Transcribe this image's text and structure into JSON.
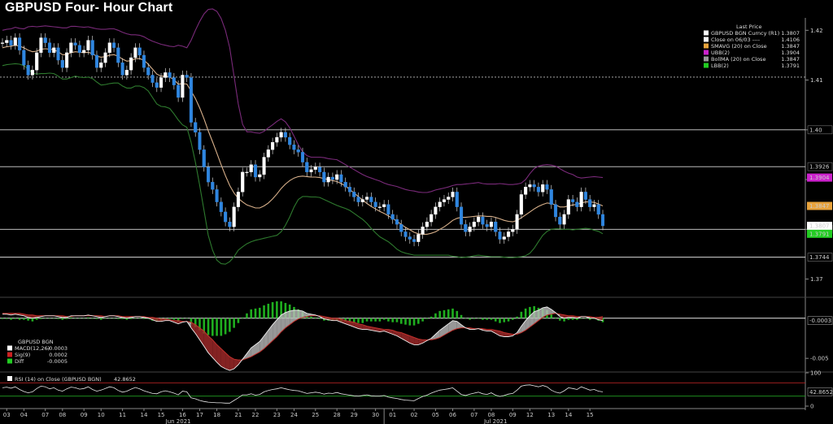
{
  "title": "GBPUSD Four- Hour Chart",
  "chart_data": [
    {
      "type": "candlestick",
      "panel": "price",
      "legend_header": "Last Price",
      "legend": [
        {
          "label": "GBPUSD BGN Curncy  (R1)",
          "value": "1.3807",
          "color": "#ffffff"
        },
        {
          "label": "Close on 06/03  ----",
          "value": "1.4106",
          "color": "#ffffff"
        },
        {
          "label": "SMAVG (20)  on Close",
          "value": "1.3847",
          "color": "#e8a33c"
        },
        {
          "label": "UBB(2)",
          "value": "1.3904",
          "color": "#cc22cc"
        },
        {
          "label": "BollMA (20)  on Close",
          "value": "1.3847",
          "color": "#999999"
        },
        {
          "label": "LBB(2)",
          "value": "1.3791",
          "color": "#22cc22"
        }
      ],
      "y_ticks": [
        "1.42",
        "1.41",
        "1.40",
        "1.39",
        "1.38",
        "1.37"
      ],
      "ylim": [
        1.3665,
        1.4225
      ],
      "horizontal_lines": [
        1.4106,
        1.4,
        1.3926,
        1.38,
        1.3744
      ],
      "line_labels": [
        "1.40",
        "1.3926",
        "1.38",
        "1.3744"
      ],
      "price_tags": [
        {
          "text": "1.3904",
          "value": 1.3904,
          "color": "#cc22cc"
        },
        {
          "text": "1.3847",
          "value": 1.3847,
          "color": "#e8a33c"
        },
        {
          "text": "1.3807",
          "value": 1.3807,
          "color": "#ffffff"
        },
        {
          "text": "1.3791",
          "value": 1.3791,
          "color": "#22cc22"
        }
      ],
      "closes": [
        1.4175,
        1.418,
        1.417,
        1.4185,
        1.416,
        1.413,
        1.411,
        1.412,
        1.4155,
        1.4185,
        1.4175,
        1.4155,
        1.4165,
        1.414,
        1.4125,
        1.4155,
        1.4175,
        1.417,
        1.4155,
        1.416,
        1.418,
        1.415,
        1.4125,
        1.4135,
        1.4155,
        1.4175,
        1.4165,
        1.4135,
        1.411,
        1.412,
        1.4145,
        1.4165,
        1.415,
        1.4125,
        1.411,
        1.4095,
        1.4085,
        1.4105,
        1.4115,
        1.4105,
        1.409,
        1.4065,
        1.411,
        1.4105,
        1.4015,
        1.3995,
        1.396,
        1.3925,
        1.3895,
        1.388,
        1.3855,
        1.3835,
        1.3815,
        1.3805,
        1.3845,
        1.3875,
        1.3915,
        1.3915,
        1.393,
        1.3905,
        1.391,
        1.3945,
        1.396,
        1.3975,
        1.3985,
        1.3995,
        1.3985,
        1.397,
        1.396,
        1.3955,
        1.3935,
        1.3915,
        1.392,
        1.3925,
        1.3915,
        1.3895,
        1.3905,
        1.39,
        1.391,
        1.3895,
        1.3885,
        1.3875,
        1.3865,
        1.3855,
        1.386,
        1.3865,
        1.3855,
        1.3845,
        1.3845,
        1.385,
        1.383,
        1.382,
        1.381,
        1.3795,
        1.3785,
        1.378,
        1.3775,
        1.379,
        1.3805,
        1.3815,
        1.383,
        1.3845,
        1.3855,
        1.386,
        1.3865,
        1.3875,
        1.3845,
        1.381,
        1.3795,
        1.3805,
        1.3815,
        1.3825,
        1.381,
        1.3805,
        1.3815,
        1.3795,
        1.378,
        1.3785,
        1.3795,
        1.38,
        1.383,
        1.387,
        1.3885,
        1.389,
        1.3885,
        1.3875,
        1.389,
        1.388,
        1.385,
        1.3825,
        1.381,
        1.383,
        1.386,
        1.3855,
        1.3845,
        1.3875,
        1.386,
        1.3845,
        1.385,
        1.383,
        1.3807
      ],
      "sma20": [
        1.4165,
        1.4167,
        1.4168,
        1.417,
        1.4168,
        1.4165,
        1.416,
        1.4157,
        1.4158,
        1.4162,
        1.4163,
        1.4162,
        1.4161,
        1.4157,
        1.4151,
        1.4151,
        1.4155,
        1.4157,
        1.4156,
        1.4155,
        1.4156,
        1.4153,
        1.4148,
        1.4146,
        1.4147,
        1.415,
        1.4151,
        1.4148,
        1.4142,
        1.4138,
        1.4139,
        1.4143,
        1.4143,
        1.414,
        1.4132,
        1.4122,
        1.4112,
        1.4108,
        1.4108,
        1.4106,
        1.4101,
        1.4092,
        1.4093,
        1.4092,
        1.4078,
        1.4063,
        1.4044,
        1.4022,
        1.3998,
        1.3976,
        1.3953,
        1.393,
        1.3908,
        1.3888,
        1.3873,
        1.3862,
        1.3855,
        1.3849,
        1.3846,
        1.3843,
        1.3843,
        1.3847,
        1.3853,
        1.3861,
        1.3871,
        1.3882,
        1.3891,
        1.3898,
        1.3903,
        1.3906,
        1.3907,
        1.3906,
        1.3905,
        1.3905,
        1.3904,
        1.3902,
        1.39,
        1.3898,
        1.3896,
        1.3892,
        1.3887,
        1.388,
        1.3873,
        1.3866,
        1.3859,
        1.3852,
        1.3846,
        1.3841,
        1.3836,
        1.3832,
        1.3827,
        1.3822,
        1.3816,
        1.381,
        1.3804,
        1.3799,
        1.3794,
        1.3791,
        1.379,
        1.379,
        1.3792,
        1.3795,
        1.38,
        1.3805,
        1.3811,
        1.3818,
        1.3822,
        1.3824,
        1.3824,
        1.3825,
        1.3826,
        1.3827,
        1.3827,
        1.3826,
        1.3826,
        1.3824,
        1.3821,
        1.3818,
        1.3816,
        1.3815,
        1.3818,
        1.3823,
        1.3829,
        1.3835,
        1.3841,
        1.3846,
        1.385,
        1.3853,
        1.3852,
        1.3849,
        1.3845,
        1.3845,
        1.3847,
        1.3849,
        1.385,
        1.3853,
        1.3855,
        1.3855,
        1.3854,
        1.3851,
        1.3847
      ],
      "ubb": [
        1.42,
        1.4202,
        1.4203,
        1.4206,
        1.4204,
        1.4203,
        1.4207,
        1.4208,
        1.4207,
        1.4208,
        1.4209,
        1.4208,
        1.4207,
        1.4206,
        1.4205,
        1.4205,
        1.4208,
        1.4208,
        1.4207,
        1.4206,
        1.4207,
        1.4205,
        1.4203,
        1.4202,
        1.4202,
        1.4203,
        1.4203,
        1.42,
        1.4196,
        1.4193,
        1.4191,
        1.4191,
        1.419,
        1.4187,
        1.4182,
        1.4178,
        1.4175,
        1.4172,
        1.417,
        1.4168,
        1.4167,
        1.417,
        1.4168,
        1.4165,
        1.418,
        1.42,
        1.4218,
        1.4233,
        1.4242,
        1.4243,
        1.4238,
        1.4224,
        1.42,
        1.4165,
        1.4108,
        1.4052,
        1.4011,
        1.3996,
        1.3996,
        1.3994,
        1.3993,
        1.3997,
        1.4004,
        1.401,
        1.4017,
        1.4022,
        1.4016,
        1.4004,
        1.3987,
        1.397,
        1.3956,
        1.3948,
        1.3945,
        1.3945,
        1.3945,
        1.3944,
        1.3942,
        1.3941,
        1.394,
        1.3935,
        1.393,
        1.3925,
        1.392,
        1.3915,
        1.391,
        1.3906,
        1.3903,
        1.39,
        1.3897,
        1.3893,
        1.389,
        1.3888,
        1.3886,
        1.3883,
        1.388,
        1.3878,
        1.3877,
        1.3875,
        1.3874,
        1.3874,
        1.3876,
        1.3879,
        1.3881,
        1.3883,
        1.3885,
        1.3888,
        1.389,
        1.389,
        1.3891,
        1.3892,
        1.3893,
        1.3894,
        1.3892,
        1.3891,
        1.3891,
        1.3891,
        1.3892,
        1.3891,
        1.389,
        1.389,
        1.3891,
        1.3893,
        1.39,
        1.3912,
        1.3922,
        1.3927,
        1.3929,
        1.393,
        1.3929,
        1.3927,
        1.3922,
        1.3917,
        1.3913,
        1.391,
        1.3905,
        1.3903,
        1.3904,
        1.3905,
        1.3906,
        1.3905,
        1.3904
      ],
      "lbb": [
        1.4129,
        1.4131,
        1.4132,
        1.4133,
        1.4132,
        1.4129,
        1.4122,
        1.4114,
        1.4112,
        1.4113,
        1.4113,
        1.4114,
        1.4113,
        1.4108,
        1.4102,
        1.4102,
        1.4105,
        1.4108,
        1.4106,
        1.4105,
        1.4106,
        1.4103,
        1.4096,
        1.409,
        1.4091,
        1.4093,
        1.4094,
        1.4094,
        1.4088,
        1.4084,
        1.4084,
        1.4088,
        1.4088,
        1.4085,
        1.4078,
        1.4065,
        1.4052,
        1.4047,
        1.4046,
        1.4043,
        1.4032,
        1.402,
        1.401,
        1.4005,
        1.3975,
        1.3935,
        1.3888,
        1.3838,
        1.3788,
        1.3758,
        1.3738,
        1.3731,
        1.373,
        1.3735,
        1.3745,
        1.3758,
        1.3765,
        1.3771,
        1.3775,
        1.3778,
        1.378,
        1.3782,
        1.3784,
        1.3786,
        1.3788,
        1.3795,
        1.3808,
        1.3825,
        1.3845,
        1.386,
        1.3866,
        1.3866,
        1.3865,
        1.3865,
        1.3864,
        1.386,
        1.3856,
        1.3852,
        1.3848,
        1.3845,
        1.3842,
        1.3838,
        1.3832,
        1.3826,
        1.382,
        1.3812,
        1.3802,
        1.3793,
        1.3785,
        1.378,
        1.3775,
        1.3768,
        1.376,
        1.3755,
        1.3752,
        1.375,
        1.3748,
        1.3748,
        1.3748,
        1.3748,
        1.3748,
        1.3748,
        1.3748,
        1.3748,
        1.3748,
        1.3746,
        1.3745,
        1.3743,
        1.3744,
        1.3745,
        1.3747,
        1.3748,
        1.3747,
        1.3746,
        1.3745,
        1.3745,
        1.3745,
        1.3744,
        1.3743,
        1.3743,
        1.3744,
        1.3745,
        1.3747,
        1.3752,
        1.3762,
        1.3775,
        1.3788,
        1.3796,
        1.38,
        1.3801,
        1.3801,
        1.38,
        1.38,
        1.3799,
        1.38,
        1.3801,
        1.3802,
        1.3801,
        1.3798,
        1.3796,
        1.3791
      ]
    },
    {
      "type": "macd",
      "panel": "macd",
      "legend_header": "GBPUSD BGN",
      "legend": [
        {
          "label": "MACD(12,26)",
          "value": "-0.0003",
          "color": "#ffffff"
        },
        {
          "label": "Sig(9)",
          "value": "0.0002",
          "color": "#cc2222"
        },
        {
          "label": "Diff",
          "value": "-0.0005",
          "color": "#22cc22"
        }
      ],
      "y_ticks": [
        "-0.005"
      ],
      "ylim": [
        -0.0065,
        0.0022
      ],
      "last_tag": "-0.0003",
      "last_tag_value": -0.0003,
      "macd": [
        0.0005,
        0.0005,
        0.0004,
        0.0005,
        0.0004,
        0.0003,
        0.0001,
        0.0,
        0.0001,
        0.0002,
        0.0003,
        0.0003,
        0.0003,
        0.0002,
        0.0001,
        0.0001,
        0.0003,
        0.0003,
        0.0003,
        0.0003,
        0.0004,
        0.0003,
        0.0002,
        0.0001,
        0.0002,
        0.0003,
        0.0003,
        0.0002,
        0.0001,
        0.0,
        0.0001,
        0.0002,
        0.0002,
        0.0001,
        -0.0,
        -0.0002,
        -0.0004,
        -0.0004,
        -0.0003,
        -0.0003,
        -0.0005,
        -0.0007,
        -0.0005,
        -0.0004,
        -0.0012,
        -0.0019,
        -0.0027,
        -0.0035,
        -0.0043,
        -0.0049,
        -0.0055,
        -0.006,
        -0.0063,
        -0.0065,
        -0.0063,
        -0.0058,
        -0.0051,
        -0.0044,
        -0.0037,
        -0.0033,
        -0.0029,
        -0.0022,
        -0.0015,
        -0.0008,
        -0.0002,
        0.0004,
        0.0007,
        0.0009,
        0.001,
        0.001,
        0.0009,
        0.0006,
        0.0005,
        0.0004,
        0.0002,
        -0.0001,
        -0.0002,
        -0.0003,
        -0.0003,
        -0.0005,
        -0.0007,
        -0.0009,
        -0.0011,
        -0.0013,
        -0.0014,
        -0.0014,
        -0.0015,
        -0.0016,
        -0.0017,
        -0.0016,
        -0.0018,
        -0.002,
        -0.0022,
        -0.0025,
        -0.0028,
        -0.0031,
        -0.0033,
        -0.0033,
        -0.0031,
        -0.0028,
        -0.0025,
        -0.002,
        -0.0015,
        -0.0011,
        -0.0007,
        -0.0003,
        -0.0004,
        -0.0008,
        -0.0012,
        -0.0014,
        -0.0014,
        -0.0013,
        -0.0015,
        -0.0016,
        -0.0016,
        -0.0019,
        -0.0022,
        -0.0023,
        -0.0023,
        -0.0022,
        -0.0018,
        -0.001,
        -0.0003,
        0.0003,
        0.0008,
        0.001,
        0.0013,
        0.0014,
        0.0011,
        0.0007,
        0.0002,
        0.0,
        0.0001,
        0.0001,
        0.0,
        0.0002,
        0.0002,
        0.0,
        -0.0,
        -0.0002,
        -0.0003
      ],
      "signal": [
        0.0006,
        0.0006,
        0.0006,
        0.0006,
        0.0006,
        0.0005,
        0.0004,
        0.0004,
        0.0003,
        0.0003,
        0.0003,
        0.0003,
        0.0003,
        0.0003,
        0.0003,
        0.0002,
        0.0002,
        0.0003,
        0.0003,
        0.0003,
        0.0003,
        0.0003,
        0.0003,
        0.0003,
        0.0002,
        0.0003,
        0.0003,
        0.0003,
        0.0002,
        0.0002,
        0.0002,
        0.0002,
        0.0002,
        0.0002,
        0.0001,
        0.0001,
        -0.0,
        -0.0001,
        -0.0001,
        -0.0002,
        -0.0003,
        -0.0003,
        -0.0004,
        -0.0004,
        -0.0005,
        -0.0008,
        -0.0012,
        -0.0016,
        -0.0022,
        -0.0027,
        -0.0033,
        -0.0038,
        -0.0043,
        -0.0048,
        -0.0051,
        -0.0052,
        -0.0052,
        -0.005,
        -0.0048,
        -0.0045,
        -0.0042,
        -0.0038,
        -0.0033,
        -0.0028,
        -0.0023,
        -0.0017,
        -0.0012,
        -0.0008,
        -0.0004,
        -0.0001,
        0.0001,
        0.0002,
        0.0003,
        0.0003,
        0.0003,
        0.0002,
        0.0001,
        0.0,
        -0.0,
        -0.0001,
        -0.0003,
        -0.0004,
        -0.0005,
        -0.0007,
        -0.0008,
        -0.001,
        -0.0011,
        -0.0012,
        -0.0013,
        -0.0014,
        -0.0014,
        -0.0015,
        -0.0017,
        -0.0018,
        -0.002,
        -0.0022,
        -0.0024,
        -0.0026,
        -0.0027,
        -0.0027,
        -0.0027,
        -0.0026,
        -0.0024,
        -0.0021,
        -0.0018,
        -0.0015,
        -0.0013,
        -0.0012,
        -0.0012,
        -0.0012,
        -0.0013,
        -0.0013,
        -0.0013,
        -0.0014,
        -0.0014,
        -0.0015,
        -0.0016,
        -0.0018,
        -0.0019,
        -0.002,
        -0.002,
        -0.0018,
        -0.0015,
        -0.0011,
        -0.0007,
        -0.0003,
        0.0001,
        0.0004,
        0.0005,
        0.0006,
        0.0005,
        0.0004,
        0.0003,
        0.0003,
        0.0002,
        0.0002,
        0.0002,
        0.0002,
        0.0001,
        0.0001,
        0.0002
      ]
    },
    {
      "type": "line",
      "panel": "rsi",
      "legend": [
        {
          "label": "RSI (14)  on Close (GBPUSD BGN)",
          "value": "42.8652",
          "color": "#ffffff"
        }
      ],
      "y_ticks": [
        "100",
        "0"
      ],
      "ylim": [
        0,
        100
      ],
      "reference_lines": [
        70,
        30
      ],
      "last_tag": "42.8652",
      "last_tag_value": 42.8652,
      "values": [
        55,
        57,
        54,
        58,
        50,
        44,
        40,
        43,
        53,
        60,
        58,
        52,
        55,
        48,
        45,
        52,
        57,
        55,
        51,
        53,
        58,
        50,
        45,
        48,
        53,
        58,
        55,
        47,
        42,
        45,
        51,
        56,
        52,
        46,
        42,
        38,
        37,
        43,
        46,
        43,
        39,
        34,
        45,
        43,
        25,
        22,
        17,
        14,
        12,
        11,
        10,
        10,
        9,
        9,
        17,
        25,
        34,
        34,
        37,
        33,
        35,
        43,
        47,
        50,
        52,
        55,
        52,
        49,
        47,
        46,
        42,
        38,
        40,
        42,
        40,
        36,
        39,
        38,
        41,
        37,
        35,
        33,
        31,
        30,
        32,
        34,
        31,
        30,
        30,
        32,
        27,
        25,
        23,
        20,
        18,
        17,
        16,
        23,
        29,
        33,
        39,
        44,
        48,
        50,
        52,
        55,
        45,
        35,
        32,
        36,
        39,
        42,
        37,
        35,
        40,
        33,
        29,
        32,
        36,
        38,
        48,
        60,
        63,
        64,
        61,
        58,
        62,
        58,
        48,
        42,
        39,
        46,
        55,
        53,
        50,
        58,
        53,
        48,
        50,
        45,
        42.8652
      ],
      "x_ticks": [
        "03",
        "04",
        "07",
        "08",
        "09",
        "10",
        "11",
        "14",
        "15",
        "16",
        "17",
        "18",
        "21",
        "22",
        "23",
        "24",
        "25",
        "28",
        "29",
        "30",
        "01",
        "02",
        "05",
        "06",
        "07",
        "08",
        "09",
        "12",
        "13",
        "14",
        "15"
      ],
      "x_tick_labels": [
        "Jun 2021",
        "Jul 2021"
      ]
    }
  ]
}
